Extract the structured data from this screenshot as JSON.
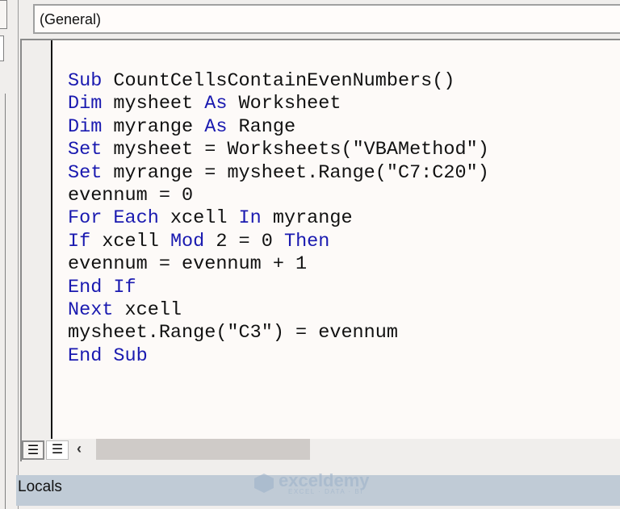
{
  "procedure_dropdown": {
    "value": "(General)"
  },
  "code_lines": [
    [
      {
        "t": "Sub",
        "k": true
      },
      {
        "t": " CountCellsContainEvenNumbers()"
      }
    ],
    [
      {
        "t": "Dim",
        "k": true
      },
      {
        "t": " mysheet "
      },
      {
        "t": "As",
        "k": true
      },
      {
        "t": " Worksheet"
      }
    ],
    [
      {
        "t": "Dim",
        "k": true
      },
      {
        "t": " myrange "
      },
      {
        "t": "As",
        "k": true
      },
      {
        "t": " Range"
      }
    ],
    [
      {
        "t": "Set",
        "k": true
      },
      {
        "t": " mysheet = Worksheets(\"VBAMethod\")"
      }
    ],
    [
      {
        "t": "Set",
        "k": true
      },
      {
        "t": " myrange = mysheet.Range(\"C7:C20\")"
      }
    ],
    [
      {
        "t": "evennum = 0"
      }
    ],
    [
      {
        "t": "For Each",
        "k": true
      },
      {
        "t": " xcell "
      },
      {
        "t": "In",
        "k": true
      },
      {
        "t": " myrange"
      }
    ],
    [
      {
        "t": "If",
        "k": true
      },
      {
        "t": " xcell "
      },
      {
        "t": "Mod",
        "k": true
      },
      {
        "t": " 2 = 0 "
      },
      {
        "t": "Then",
        "k": true
      }
    ],
    [
      {
        "t": "evennum = evennum + 1"
      }
    ],
    [
      {
        "t": "End If",
        "k": true
      }
    ],
    [
      {
        "t": "Next",
        "k": true
      },
      {
        "t": " xcell"
      }
    ],
    [
      {
        "t": "mysheet.Range(\"C3\") = evennum"
      }
    ],
    [
      {
        "t": "End Sub",
        "k": true
      }
    ]
  ],
  "colors": {
    "keyword": "#1a1ab0",
    "text": "#111111"
  },
  "locals_panel": {
    "title": "Locals"
  },
  "watermark": {
    "name": "exceldemy",
    "tagline": "EXCEL · DATA · BI"
  }
}
